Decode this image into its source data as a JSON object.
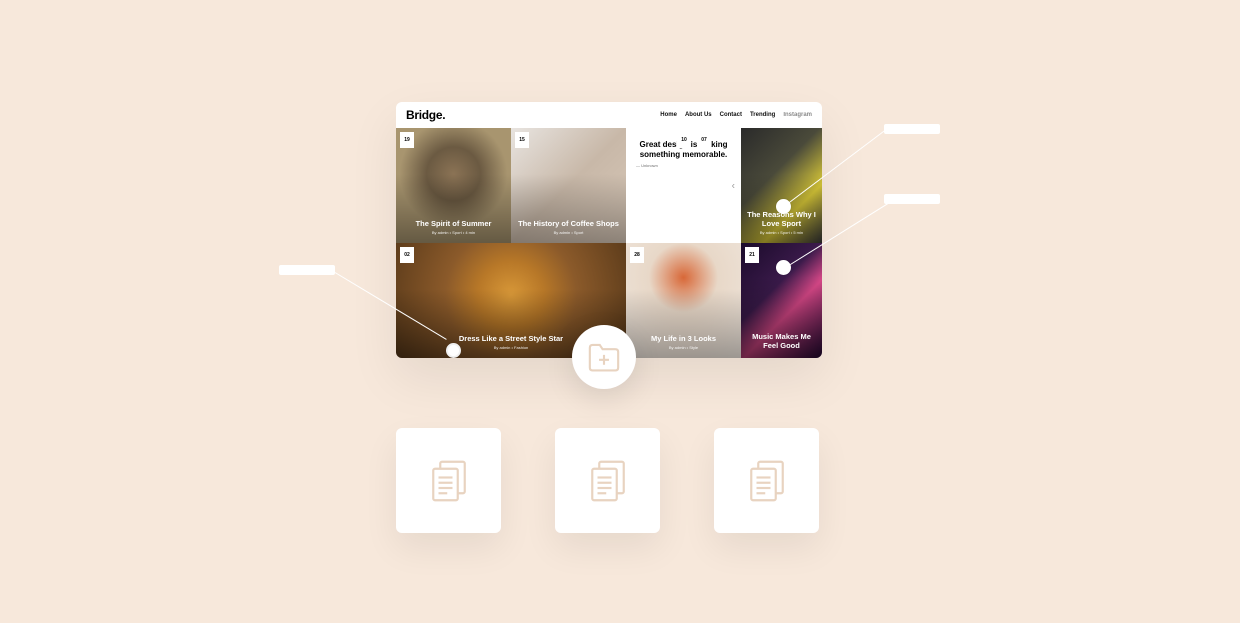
{
  "preview": {
    "logo": "Bridge.",
    "nav": [
      "Home",
      "About Us",
      "Contact",
      "Trending",
      "Instagram"
    ],
    "tiles": [
      {
        "date": "19",
        "title": "The Spirit of Summer",
        "meta": "By admin  •  Sport  •  4 min"
      },
      {
        "date": "15",
        "title": "The History of Coffee Shops",
        "meta": "By admin  •  Sport"
      },
      {
        "date_a": "10",
        "date_b": "07",
        "quote": "Great design is making something memorable.",
        "by": "— Unknown"
      },
      {
        "title": "The Reasons Why I Love Sport",
        "meta": "By admin  •  Sport  •  5 min"
      },
      {
        "date": "02",
        "title": "Dress Like a Street Style Star",
        "meta": "By admin  •  Fashion"
      },
      {
        "date": "28",
        "title": "My Life in 3 Looks",
        "meta": "By admin  •  Style"
      },
      {
        "date": "21",
        "title": "Music Makes Me Feel Good",
        "meta": ""
      }
    ]
  },
  "icons": {
    "accent": "#e8d3c0"
  }
}
